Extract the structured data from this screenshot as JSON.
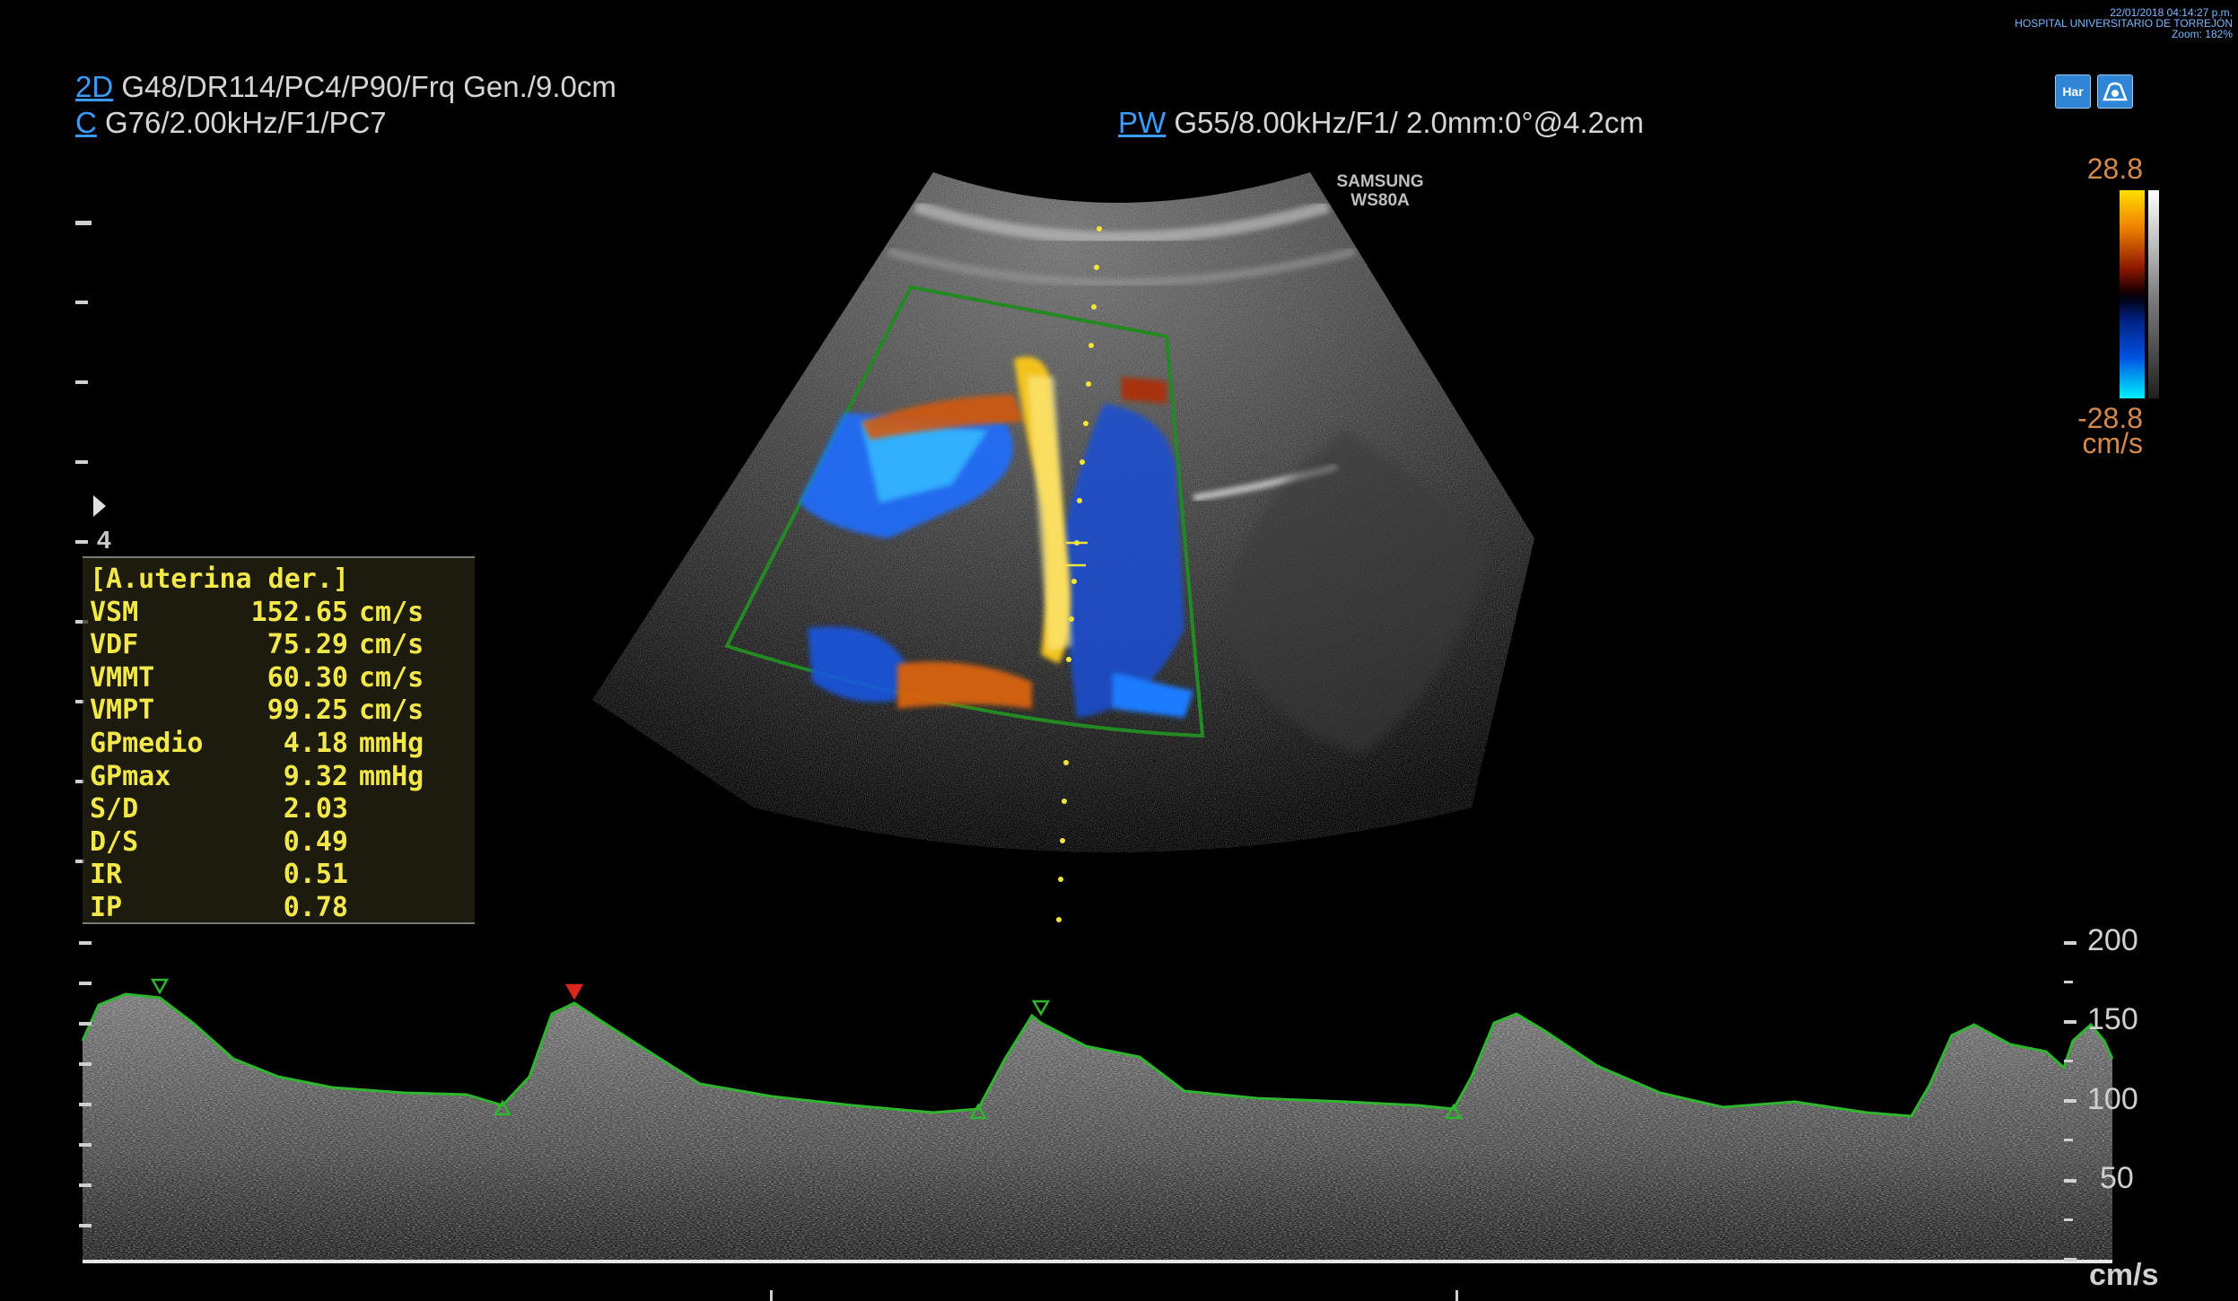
{
  "header": {
    "timestamp": "22/01/2018 04:14:27 p.m.",
    "hospital": "HOSPITAL UNIVERSITARIO DE TORREJÓN",
    "zoom": "Zoom: 182%"
  },
  "params": {
    "twod_mode": "2D",
    "twod_values": "G48/DR114/PC4/P90/Frq Gen./9.0cm",
    "color_mode": "C",
    "color_values": "G76/2.00kHz/F1/PC7",
    "pw_mode": "PW",
    "pw_values": "G55/8.00kHz/F1/ 2.0mm:0°@4.2cm"
  },
  "buttons": {
    "har": "Har"
  },
  "brand": {
    "line1": "SAMSUNG",
    "line2": "WS80A"
  },
  "color_scale": {
    "top": "28.8",
    "bottom": "-28.8",
    "unit": "cm/s"
  },
  "depth_marker": "4",
  "measurements": {
    "title": "[A.uterina der.]",
    "rows": [
      {
        "label": "VSM",
        "value": "152.65",
        "unit": "cm/s"
      },
      {
        "label": "VDF",
        "value": "75.29",
        "unit": "cm/s"
      },
      {
        "label": "VMMT",
        "value": "60.30",
        "unit": "cm/s"
      },
      {
        "label": "VMPT",
        "value": "99.25",
        "unit": "cm/s"
      },
      {
        "label": "GPmedio",
        "value": "4.18",
        "unit": "mmHg"
      },
      {
        "label": "GPmax",
        "value": "9.32",
        "unit": "mmHg"
      },
      {
        "label": "S/D",
        "value": "2.03",
        "unit": ""
      },
      {
        "label": "D/S",
        "value": "0.49",
        "unit": ""
      },
      {
        "label": "IR",
        "value": "0.51",
        "unit": ""
      },
      {
        "label": "IP",
        "value": "0.78",
        "unit": ""
      }
    ]
  },
  "spectral": {
    "scale_labels": [
      "200",
      "150",
      "100",
      "50"
    ],
    "unit": "cm/s"
  },
  "colors": {
    "mode_blue": "#3b9bff",
    "meas_yellow": "#f3e84a",
    "trace_green": "#2fb52f",
    "scale_orange": "#d58a4a"
  }
}
